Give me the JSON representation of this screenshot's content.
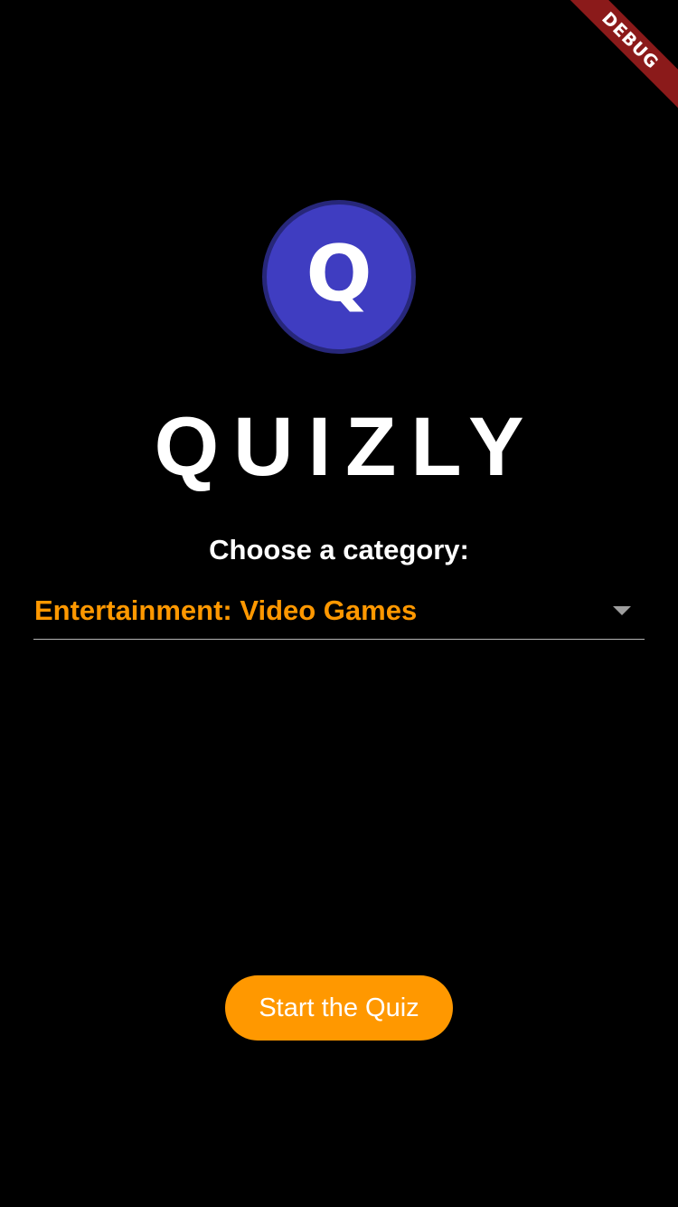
{
  "debug_banner": {
    "label": "DEBUG"
  },
  "logo": {
    "letter": "Q",
    "icon": "quiz-logo-icon"
  },
  "app": {
    "title": "QUIZLY"
  },
  "category": {
    "prompt": "Choose a category:",
    "selected": "Entertainment: Video Games",
    "arrow_icon": "dropdown-arrow-icon"
  },
  "actions": {
    "start_label": "Start the Quiz"
  },
  "colors": {
    "background": "#000000",
    "accent": "#ff9800",
    "logo_fill": "#3f3dc1",
    "logo_border": "#27277a",
    "debug_banner": "#8b1a1a",
    "text": "#ffffff"
  }
}
